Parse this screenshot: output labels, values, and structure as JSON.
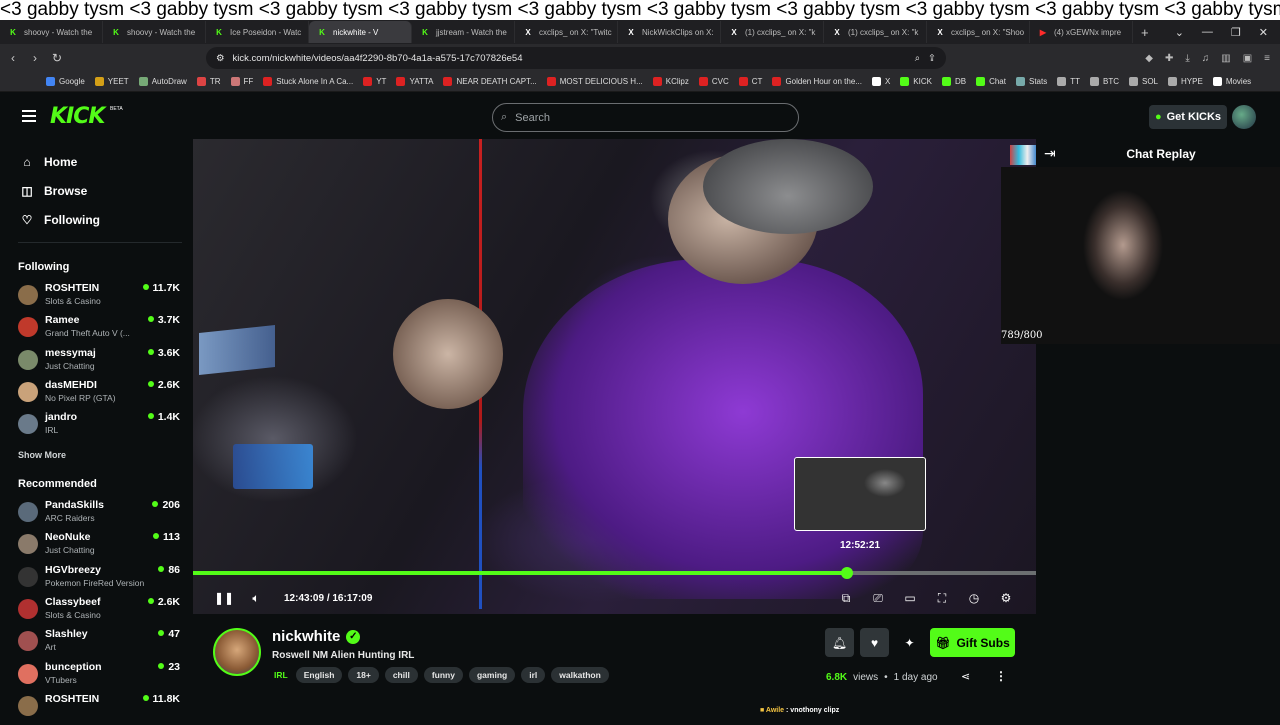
{
  "ticker": "<3 gabby tysm <3 gabby tysm <3 gabby tysm <3 gabby tysm <3 gabby tysm <3 gabby tysm <3 gabby tysm <3 gabby tysm <3 gabby tysm <3 gabby tysm <3 gabby tysm <3 gabby tysm",
  "tabs": [
    {
      "icon": "k",
      "label": "shoovy - Watch the"
    },
    {
      "icon": "k",
      "label": "shoovy - Watch the"
    },
    {
      "icon": "k",
      "label": "Ice Poseidon - Watc"
    },
    {
      "icon": "k",
      "label": "nickwhite - V"
    },
    {
      "icon": "k",
      "label": "jjstream - Watch the"
    },
    {
      "icon": "x",
      "label": "cxclips_ on X: \"Twitc"
    },
    {
      "icon": "x",
      "label": "NickWickClips on X:"
    },
    {
      "icon": "x",
      "label": "(1) cxclips_ on X: \"k"
    },
    {
      "icon": "x",
      "label": "(1) cxclips_ on X: \"k"
    },
    {
      "icon": "x",
      "label": "cxclips_ on X: \"Shoo"
    },
    {
      "icon": "y",
      "label": "(4) xGEWNx impre"
    }
  ],
  "url": "kick.com/nickwhite/videos/aa4f2290-8b70-4a1a-a575-17c707826e54",
  "bookmarks": [
    "Google",
    "YEET",
    "AutoDraw",
    "TR",
    "FF",
    "Stuck Alone In A Ca...",
    "YT",
    "YATTA",
    "NEAR DEATH CAPT...",
    "MOST DELICIOUS H...",
    "KClipz",
    "CVC",
    "CT",
    "Golden Hour on the...",
    "X",
    "KICK",
    "DB",
    "Chat",
    "Stats",
    "TT",
    "BTC",
    "SOL",
    "HYPE",
    "Movies"
  ],
  "header": {
    "search_placeholder": "Search",
    "get_kicks": "Get KICKs",
    "logo": "KICK",
    "beta": "BETA"
  },
  "nav": {
    "home": "Home",
    "browse": "Browse",
    "following": "Following"
  },
  "sidebar": {
    "following_title": "Following",
    "following": [
      {
        "name": "ROSHTEIN",
        "category": "Slots & Casino",
        "viewers": "11.7K",
        "color": "#8a6d4a"
      },
      {
        "name": "Ramee",
        "category": "Grand Theft Auto V (...",
        "viewers": "3.7K",
        "color": "#c0392b"
      },
      {
        "name": "messymaj",
        "category": "Just Chatting",
        "viewers": "3.6K",
        "color": "#7a8a6a"
      },
      {
        "name": "dasMEHDI",
        "category": "No Pixel RP (GTA)",
        "viewers": "2.6K",
        "color": "#c9a27a"
      },
      {
        "name": "jandro",
        "category": "IRL",
        "viewers": "1.4K",
        "color": "#6a7a8a"
      }
    ],
    "show_more": "Show More",
    "recommended_title": "Recommended",
    "recommended": [
      {
        "name": "PandaSkills",
        "category": "ARC Raiders",
        "viewers": "206",
        "color": "#5a6a7a"
      },
      {
        "name": "NeoNuke",
        "category": "Just Chatting",
        "viewers": "113",
        "color": "#8a7a6a"
      },
      {
        "name": "HGVbreezy",
        "category": "Pokemon FireRed Version",
        "viewers": "86",
        "color": "#333"
      },
      {
        "name": "Classybeef",
        "category": "Slots & Casino",
        "viewers": "2.6K",
        "color": "#b03030"
      },
      {
        "name": "Slashley",
        "category": "Art",
        "viewers": "47",
        "color": "#a05050"
      },
      {
        "name": "bunception",
        "category": "VTubers",
        "viewers": "23",
        "color": "#e07060"
      },
      {
        "name": "ROSHTEIN",
        "category": "",
        "viewers": "11.8K",
        "color": "#8a6d4a"
      }
    ]
  },
  "player": {
    "current_time": "12:43:09",
    "duration": "16:17:09",
    "time_sep": "/",
    "preview_time": "12:52:21",
    "progress": 0.776,
    "hover": 0.79
  },
  "chat": {
    "title": "Chat Replay",
    "counter": "789/800",
    "message_user": "Awile",
    "message_text": ": vnothony clipz"
  },
  "video": {
    "channel": "nickwhite",
    "title": "Roswell NM Alien Hunting IRL",
    "category": "IRL",
    "tags": [
      "English",
      "18+",
      "chill",
      "funny",
      "gaming",
      "irl",
      "walkathon"
    ],
    "views": "6.8K",
    "views_label": "views",
    "dot": "•",
    "age": "1 day ago",
    "gift_subs": "Gift Subs"
  },
  "colors": {
    "accent": "#53fc18",
    "bg": "#0b0e0f"
  }
}
